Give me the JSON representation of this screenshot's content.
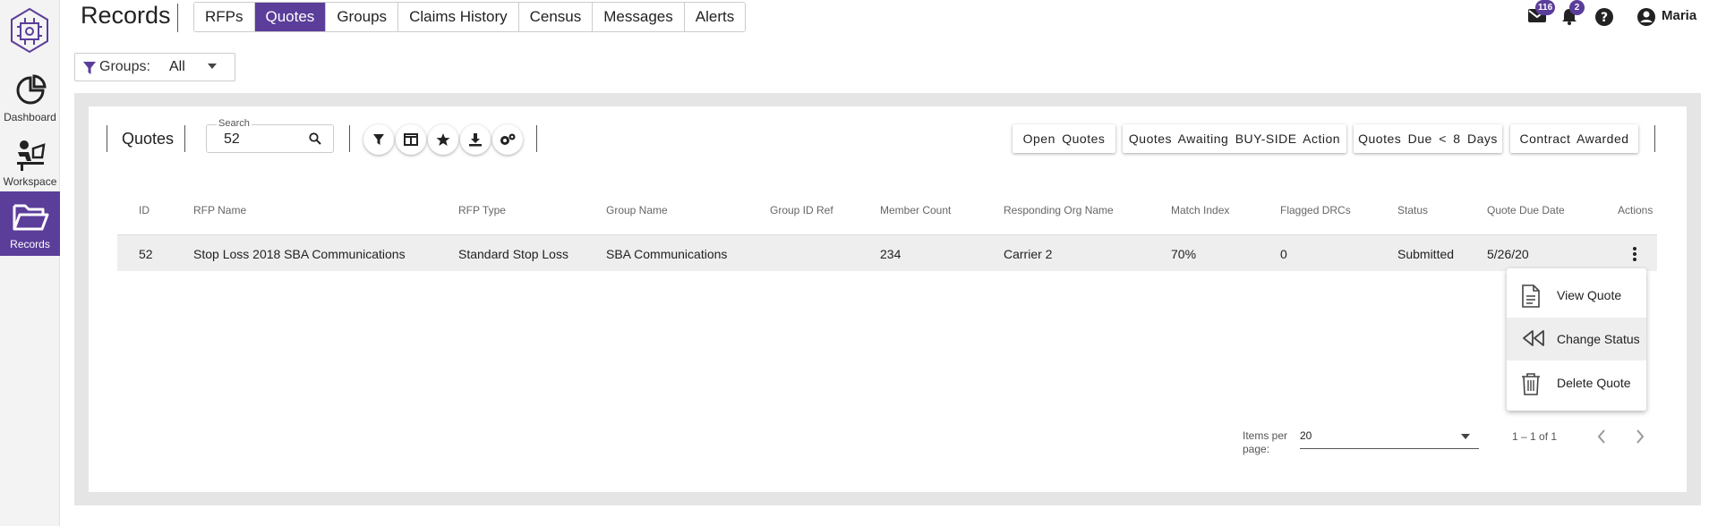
{
  "nav": {
    "items": [
      {
        "label": "Dashboard",
        "icon": "pie-chart-icon"
      },
      {
        "label": "Workspace",
        "icon": "desk-worker-icon"
      },
      {
        "label": "Records",
        "icon": "folder-open-icon"
      }
    ],
    "active": "Records",
    "accent": "#5b3d9a"
  },
  "header": {
    "title": "Records",
    "tabs": [
      "RFPs",
      "Quotes",
      "Groups",
      "Claims History",
      "Census",
      "Messages",
      "Alerts"
    ],
    "active_tab": "Quotes",
    "mail_count": "116",
    "alert_count": "2",
    "user": "Maria"
  },
  "groups_filter": {
    "label": "Groups:",
    "value": "All"
  },
  "section": {
    "title": "Quotes"
  },
  "search": {
    "label": "Search",
    "value": "52"
  },
  "toolbar_icons": [
    "filter-icon",
    "columns-icon",
    "star-icon",
    "download-icon",
    "settings-icon"
  ],
  "quick_filters": [
    "Open Quotes",
    "Quotes Awaiting BUY-SIDE Action",
    "Quotes Due < 8 Days",
    "Contract Awarded"
  ],
  "table": {
    "columns": [
      "ID",
      "RFP Name",
      "RFP Type",
      "Group Name",
      "Group ID Ref",
      "Member Count",
      "Responding Org Name",
      "Match Index",
      "Flagged DRCs",
      "Status",
      "Quote Due Date",
      "Actions"
    ],
    "rows": [
      [
        "52",
        "Stop Loss 2018 SBA Communications",
        "Standard Stop Loss",
        "SBA Communications",
        "",
        "234",
        "Carrier 2",
        "70%",
        "0",
        "Submitted",
        "5/26/20"
      ]
    ]
  },
  "actions_menu": [
    {
      "label": "View Quote",
      "icon": "document-icon"
    },
    {
      "label": "Change Status",
      "icon": "rewind-icon"
    },
    {
      "label": "Delete Quote",
      "icon": "trash-icon"
    }
  ],
  "paginator": {
    "items_per_page_label": "Items per page:",
    "page_size": "20",
    "range": "1 – 1 of 1"
  }
}
